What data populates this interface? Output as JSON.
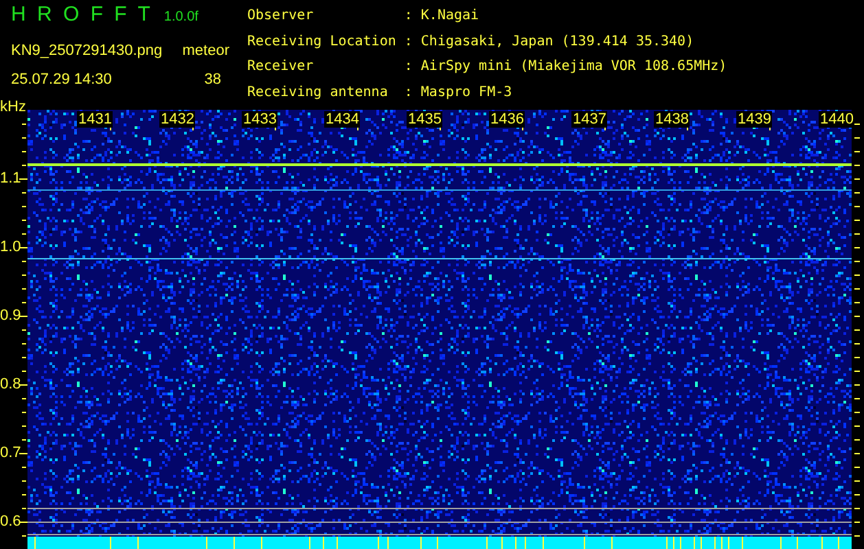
{
  "app": {
    "name": "H R O F F T",
    "version": "1.0.0f"
  },
  "file": "KN9_2507291430.png",
  "timestamp": "25.07.29 14:30",
  "detector": {
    "label": "meteor",
    "count": "38"
  },
  "info": [
    {
      "label": "Observer",
      "sep": ":",
      "value": "K.Nagai"
    },
    {
      "label": "Receiving Location",
      "sep": ":",
      "value": "Chigasaki, Japan (139.414 35.340)"
    },
    {
      "label": "Receiver",
      "sep": ":",
      "value": "AirSpy mini (Miakejima VOR 108.65MHz)"
    },
    {
      "label": "Receiving antenna",
      "sep": ":",
      "value": "Maspro FM-3"
    }
  ],
  "spectrogram": {
    "y_unit": "kHz",
    "y_labels": [
      "1.1",
      "1.0",
      "0.9",
      "0.8",
      "0.7",
      "0.6"
    ],
    "x_labels": [
      "1431",
      "1432",
      "1433",
      "1434",
      "1435",
      "1436",
      "1437",
      "1438",
      "1439",
      "1440"
    ]
  }
}
